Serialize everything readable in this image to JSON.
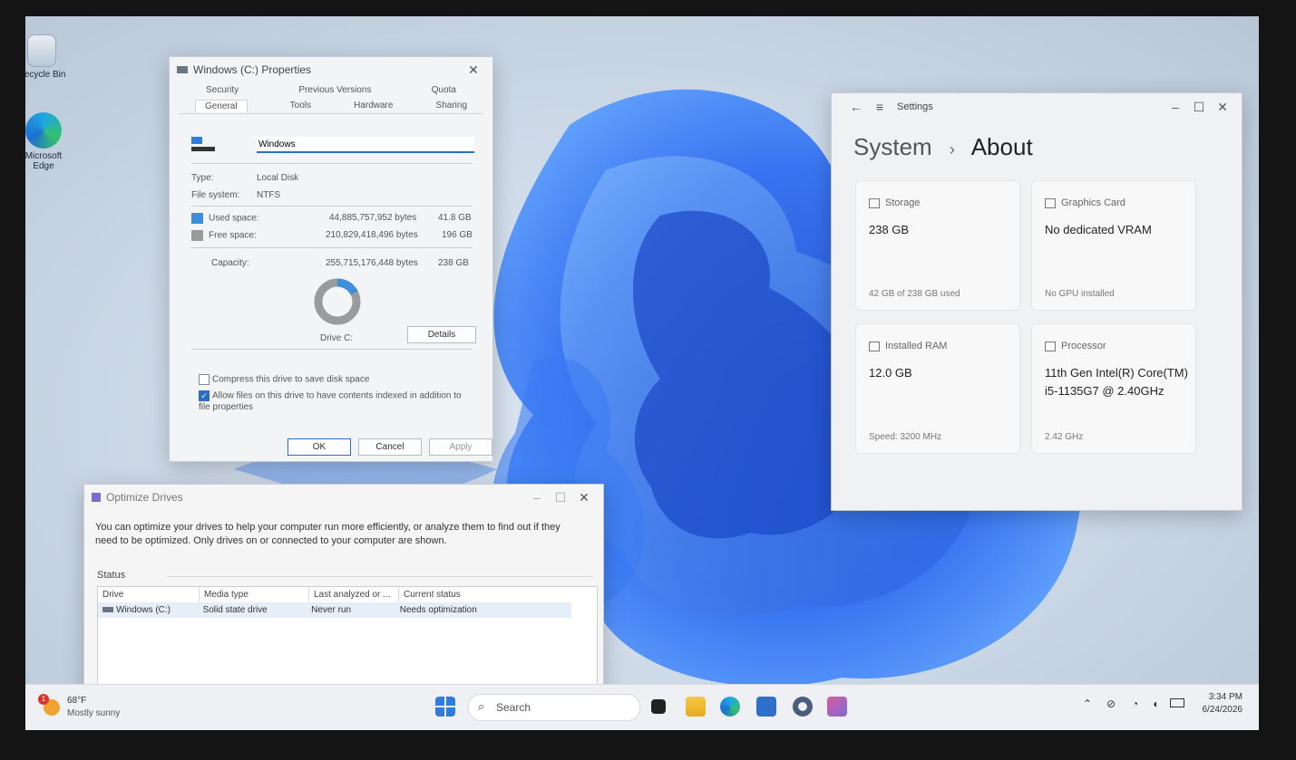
{
  "desktop": {
    "icons": [
      {
        "label": "Recycle Bin"
      },
      {
        "label": "Microsoft Edge"
      }
    ]
  },
  "properties": {
    "title": "Windows (C:) Properties",
    "tabs_back": [
      "Security",
      "Previous Versions",
      "Quota"
    ],
    "tabs_front": [
      "General",
      "Tools",
      "Hardware",
      "Sharing"
    ],
    "drive_name": "Windows",
    "type_label": "Type:",
    "type_value": "Local Disk",
    "fs_label": "File system:",
    "fs_value": "NTFS",
    "used_label": "Used space:",
    "used_bytes": "44,885,757,952 bytes",
    "used_gb": "41.8 GB",
    "free_label": "Free space:",
    "free_bytes": "210,829,418,496 bytes",
    "free_gb": "196 GB",
    "capacity_label": "Capacity:",
    "capacity_bytes": "255,715,176,448 bytes",
    "capacity_gb": "238 GB",
    "used_fraction": 0.175,
    "drive_label": "Drive C:",
    "details_button": "Details",
    "compress_label": "Compress this drive to save disk space",
    "compress_checked": false,
    "index_label": "Allow files on this drive to have contents indexed in addition to file properties",
    "index_checked": true,
    "ok": "OK",
    "cancel": "Cancel",
    "apply": "Apply",
    "used_color": "#3c8fd8",
    "free_color": "#9b9b9b"
  },
  "settings": {
    "app_title": "Settings",
    "breadcrumb_parent": "System",
    "breadcrumb_sep": "›",
    "breadcrumb_current": "About",
    "cards": {
      "storage": {
        "label": "Storage",
        "value": "238 GB",
        "sub": "42 GB of 238 GB used"
      },
      "graphics": {
        "label": "Graphics Card",
        "value": "No dedicated VRAM",
        "sub": "No GPU installed"
      },
      "ram": {
        "label": "Installed RAM",
        "value": "12.0 GB",
        "sub": "Speed: 3200 MHz"
      },
      "processor": {
        "label": "Processor",
        "value": "11th Gen Intel(R) Core(TM) i5-1135G7 @ 2.40GHz",
        "sub": "2.42 GHz"
      }
    }
  },
  "optimize": {
    "title": "Optimize Drives",
    "description": "You can optimize your drives to help your computer run more efficiently, or analyze them to find out if they need to be optimized. Only drives on or connected to your computer are shown.",
    "status_label": "Status",
    "columns": [
      "Drive",
      "Media type",
      "Last analyzed or ...",
      "Current status"
    ],
    "rows": [
      {
        "drive": "Windows (C:)",
        "media": "Solid state drive",
        "last": "Never run",
        "status": "Needs optimization"
      }
    ]
  },
  "taskbar": {
    "weather_temp": "68°F",
    "weather_desc": "Mostly sunny",
    "weather_badge": "1",
    "search_label": "Search",
    "time": "3:34 PM",
    "date": "6/24/2026"
  }
}
